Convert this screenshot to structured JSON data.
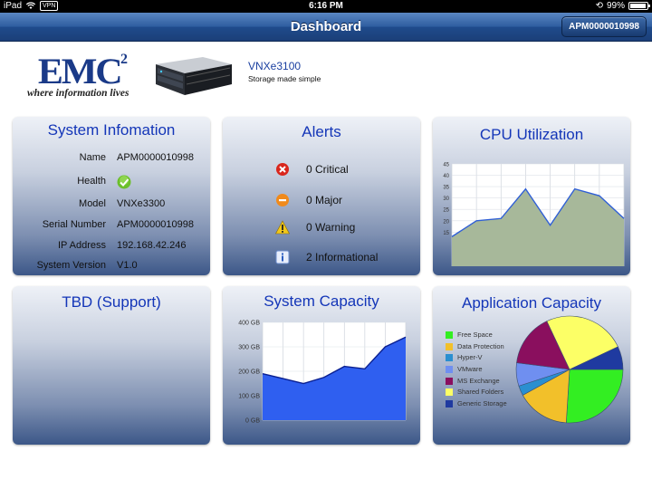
{
  "status_bar": {
    "device": "iPad",
    "vpn": "VPN",
    "time": "6:16 PM",
    "battery": "99%"
  },
  "nav": {
    "title": "Dashboard",
    "right_button": "APM0000010998"
  },
  "header": {
    "logo_text": "EMC",
    "logo_sup": "2",
    "logo_tagline": "where information lives",
    "product_name": "VNXe3100",
    "product_tagline": "Storage made simple"
  },
  "system_info": {
    "title": "System Infomation",
    "rows": [
      {
        "label": "Name",
        "value": "APM0000010998"
      },
      {
        "label": "Health",
        "value": "",
        "icon": "check-icon"
      },
      {
        "label": "Model",
        "value": "VNXe3300"
      },
      {
        "label": "Serial Number",
        "value": "APM0000010998"
      },
      {
        "label": "IP Address",
        "value": "192.168.42.246"
      },
      {
        "label": "System Version",
        "value": "V1.0"
      }
    ]
  },
  "alerts": {
    "title": "Alerts",
    "items": [
      {
        "icon": "critical-icon",
        "text": "0 Critical",
        "color": "#d9261c"
      },
      {
        "icon": "major-icon",
        "text": "0 Major",
        "color": "#f08a1c"
      },
      {
        "icon": "warning-icon",
        "text": "0 Warning",
        "color": "#f2c81a"
      },
      {
        "icon": "info-icon",
        "text": "2 Informational",
        "color": "#3a7bd5"
      }
    ]
  },
  "cpu": {
    "title": "CPU Utilization"
  },
  "tbd": {
    "title": "TBD (Support)"
  },
  "capacity": {
    "title": "System Capacity"
  },
  "app_capacity": {
    "title": "Application Capacity"
  },
  "chart_data": [
    {
      "type": "area",
      "title": "CPU Utilization",
      "x": [
        0,
        1,
        2,
        3,
        4,
        5,
        6,
        7,
        8
      ],
      "y": [
        13,
        20,
        21,
        34,
        18,
        34,
        31,
        21
      ],
      "ylim": [
        0,
        45
      ],
      "yticks": [
        "45",
        "40",
        "35",
        "30",
        "25",
        "20",
        "15"
      ],
      "grid": true,
      "fill": "#a7b89a",
      "line": "#2f5fd6"
    },
    {
      "type": "area",
      "title": "System Capacity",
      "y": [
        190,
        170,
        150,
        175,
        220,
        210,
        300,
        340
      ],
      "ylim": [
        0,
        400
      ],
      "yticks": [
        "400 GB",
        "300 GB",
        "200 GB",
        "100 GB",
        "0 GB"
      ],
      "grid": true,
      "fill": "#2f5ff0",
      "line": "#0a1f90"
    },
    {
      "type": "pie",
      "title": "Application Capacity",
      "legend_position": "left",
      "slices": [
        {
          "name": "Free Space",
          "value": 26,
          "color": "#33ee22"
        },
        {
          "name": "Data Protection",
          "value": 16,
          "color": "#f2c02a"
        },
        {
          "name": "Hyper-V",
          "value": 3,
          "color": "#2a8fd0"
        },
        {
          "name": "VMware",
          "value": 7,
          "color": "#6f8ff0"
        },
        {
          "name": "MS Exchange",
          "value": 16,
          "color": "#8a0f5e"
        },
        {
          "name": "Shared Folders",
          "value": 25,
          "color": "#fcff66"
        },
        {
          "name": "Generic Storage",
          "value": 7,
          "color": "#1f3aa0"
        }
      ]
    }
  ]
}
